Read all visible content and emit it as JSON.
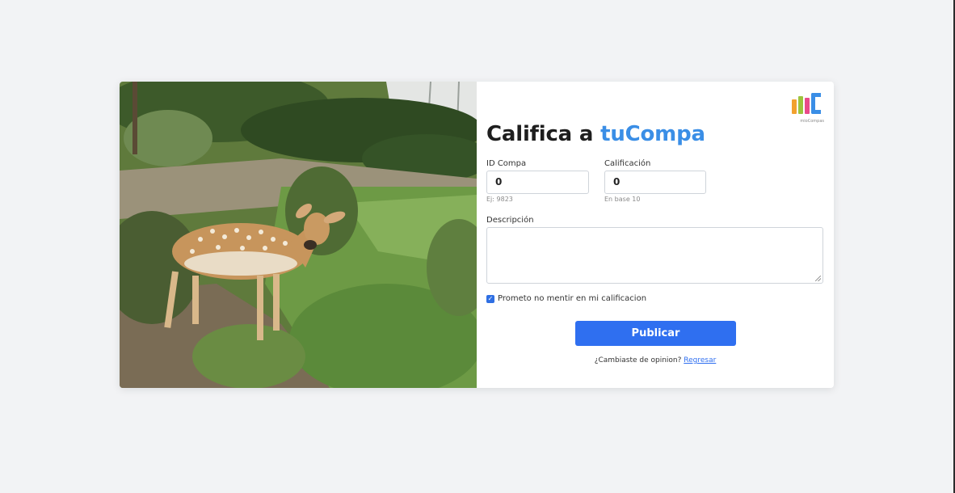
{
  "brand": {
    "logo_caption": "mioCompas",
    "colors": [
      "#f2a12e",
      "#9cc43d",
      "#e94a8a",
      "#3a8ee6"
    ]
  },
  "title": {
    "prefix": "Califica a ",
    "accent": "tuCompa",
    "accent_color": "#3a8ee6"
  },
  "form": {
    "id_label": "ID Compa",
    "id_value": "0",
    "id_hint": "Ej: 9823",
    "rating_label": "Calificación",
    "rating_value": "0",
    "rating_hint": "En base 10",
    "description_label": "Descripción",
    "description_value": "",
    "promise_label": "Prometo no mentir en mi calificacion",
    "promise_checked": true,
    "submit_label": "Publicar"
  },
  "footer": {
    "question": "¿Cambiaste de opinion? ",
    "link_label": "Regresar"
  },
  "photo": {
    "subject": "deer-photo"
  }
}
